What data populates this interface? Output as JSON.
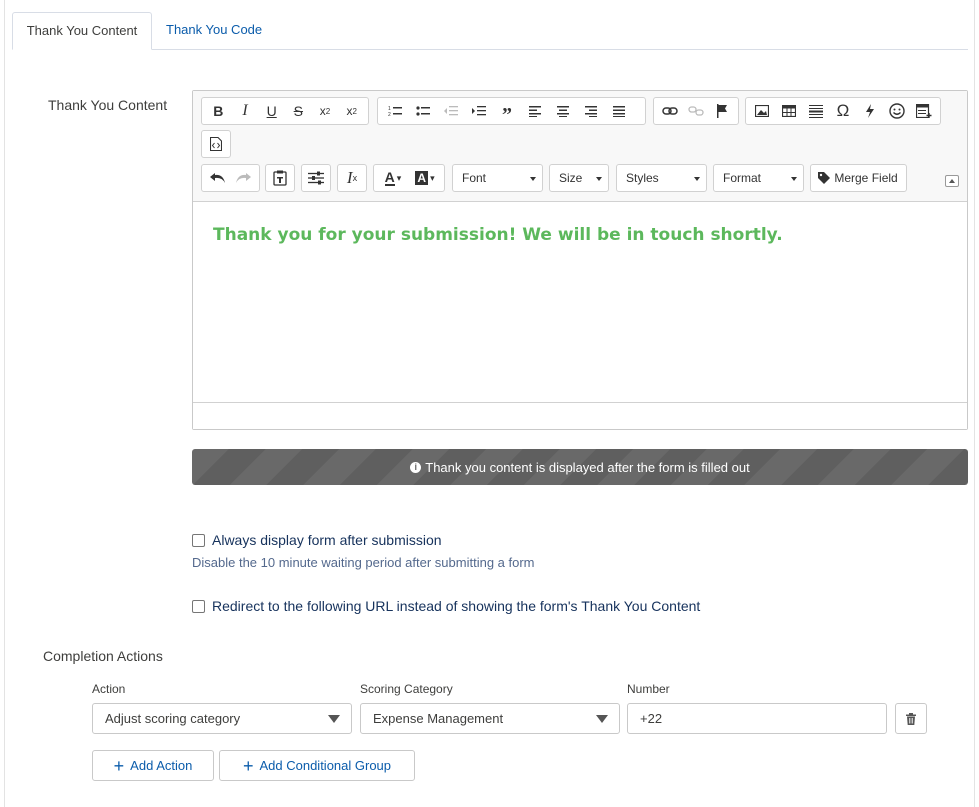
{
  "tabs": {
    "active": "Thank You Content",
    "inactive": "Thank You Code"
  },
  "field_label": "Thank You Content",
  "toolbar": {
    "row1_group1": [
      "B",
      "I",
      "U",
      "S",
      "x₂",
      "x²"
    ],
    "row1_group2": [
      "ol",
      "ul",
      "outdent",
      "indent",
      "”"
    ],
    "font_label": "Font",
    "size_label": "Size",
    "styles_label": "Styles",
    "format_label": "Format",
    "merge_field_label": "Merge Field"
  },
  "editor": {
    "content_text": "Thank you for your submission! We will be in touch shortly.",
    "content_color": "#5cb85c"
  },
  "info_bar": {
    "text": "Thank you content is displayed after the form is filled out"
  },
  "options": {
    "always_display_label": "Always display form after submission",
    "always_display_checked": false,
    "always_display_help": "Disable the 10 minute waiting period after submitting a form",
    "redirect_label": "Redirect to the following URL instead of showing the form's Thank You Content",
    "redirect_checked": false
  },
  "completion": {
    "title": "Completion Actions",
    "col_action": "Action",
    "col_category": "Scoring Category",
    "col_number": "Number",
    "action_value": "Adjust scoring category",
    "category_value": "Expense Management",
    "number_value": "+22",
    "add_action_label": "Add Action",
    "add_group_label": "Add Conditional Group"
  },
  "colors": {
    "link": "#0b5cab",
    "text": "#16325c",
    "info_bar": "#666666"
  }
}
